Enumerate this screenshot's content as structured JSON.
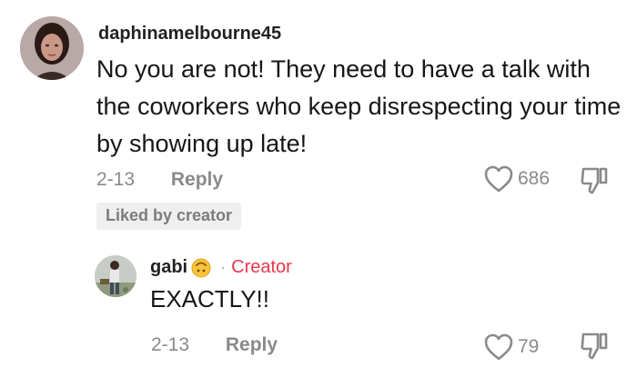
{
  "comment": {
    "username": "daphinamelbourne45",
    "text": "No you are not! They need to have a talk with the coworkers who keep disrespecting your time by showing up late!",
    "date": "2-13",
    "reply_label": "Reply",
    "like_count": "686",
    "liked_badge": "Liked by creator"
  },
  "reply": {
    "username": "gabi",
    "emoji": "upside-down-face-emoji",
    "creator_label": "Creator",
    "text": "EXACTLY!!",
    "date": "2-13",
    "reply_label": "Reply",
    "like_count": "79"
  },
  "icons": {
    "like": "heart-outline-icon",
    "dislike": "thumbs-down-outline-icon"
  },
  "colors": {
    "creator": "#e8374d",
    "meta_gray": "#8a8a8a"
  }
}
